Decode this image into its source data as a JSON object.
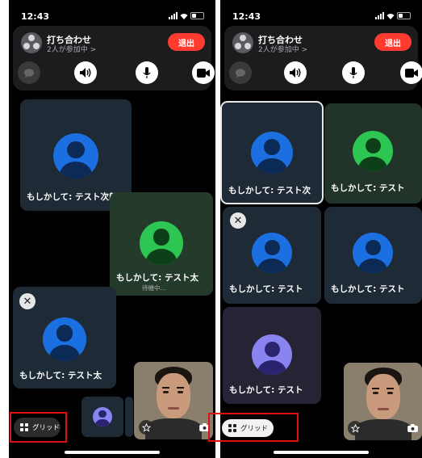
{
  "left": {
    "status": {
      "time": "12:43"
    },
    "call": {
      "title": "打ち合わせ",
      "subtitle": "2人が参加中 >",
      "leave_label": "退出",
      "controls": [
        "message-icon",
        "speaker-icon",
        "mic-icon",
        "video-icon"
      ]
    },
    "tiles": [
      {
        "name": "もしかして: テスト次郎",
        "avatar": "blue"
      },
      {
        "name": "もしかして: テスト太",
        "status": "待機中...",
        "avatar": "green"
      },
      {
        "name": "もしかして: テスト太",
        "avatar": "blue"
      }
    ],
    "grid_button": {
      "label": "グリッド"
    }
  },
  "right": {
    "status": {
      "time": "12:43"
    },
    "call": {
      "title": "打ち合わせ",
      "subtitle": "2人が参加中 >",
      "leave_label": "退出",
      "controls": [
        "message-icon",
        "speaker-icon",
        "mic-icon",
        "video-icon"
      ]
    },
    "tiles": [
      {
        "name": "もしかして: テスト次",
        "avatar": "blue"
      },
      {
        "name": "もしかして: テスト",
        "avatar": "green"
      },
      {
        "name": "もしかして: テスト",
        "avatar": "blue"
      },
      {
        "name": "もしかして: テスト",
        "avatar": "blue"
      },
      {
        "name": "もしかして: テスト",
        "avatar": "purple"
      }
    ],
    "grid_button": {
      "label": "グリッド"
    }
  },
  "colors": {
    "leave": "#ff3b30",
    "avatar_blue": "#1c6fe0",
    "avatar_green": "#2dc653",
    "avatar_purple": "#8a84f0",
    "highlight": "#e01010"
  }
}
